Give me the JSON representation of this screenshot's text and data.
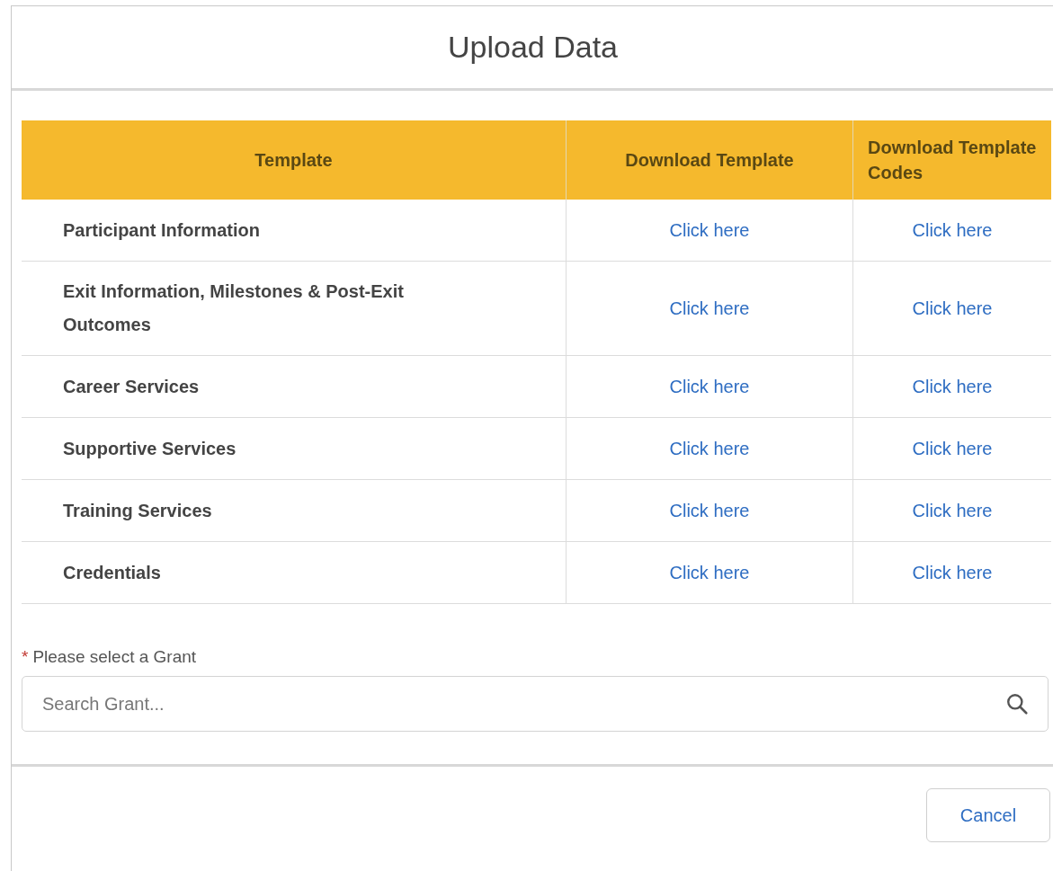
{
  "dialog": {
    "title": "Upload Data"
  },
  "table": {
    "columns": [
      "Template",
      "Download Template",
      "Download Template Codes"
    ],
    "rows": [
      {
        "template": "Participant Information",
        "download_template": "Click here",
        "download_codes": "Click here"
      },
      {
        "template": "Exit Information, Milestones & Post-Exit Outcomes",
        "download_template": "Click here",
        "download_codes": "Click here"
      },
      {
        "template": "Career Services",
        "download_template": "Click here",
        "download_codes": "Click here"
      },
      {
        "template": "Supportive Services",
        "download_template": "Click here",
        "download_codes": "Click here"
      },
      {
        "template": "Training Services",
        "download_template": "Click here",
        "download_codes": "Click here"
      },
      {
        "template": "Credentials",
        "download_template": "Click here",
        "download_codes": "Click here"
      }
    ]
  },
  "grant_field": {
    "required_mark": "*",
    "label": "Please select a Grant",
    "placeholder": "Search Grant..."
  },
  "buttons": [
    "Cancel"
  ]
}
